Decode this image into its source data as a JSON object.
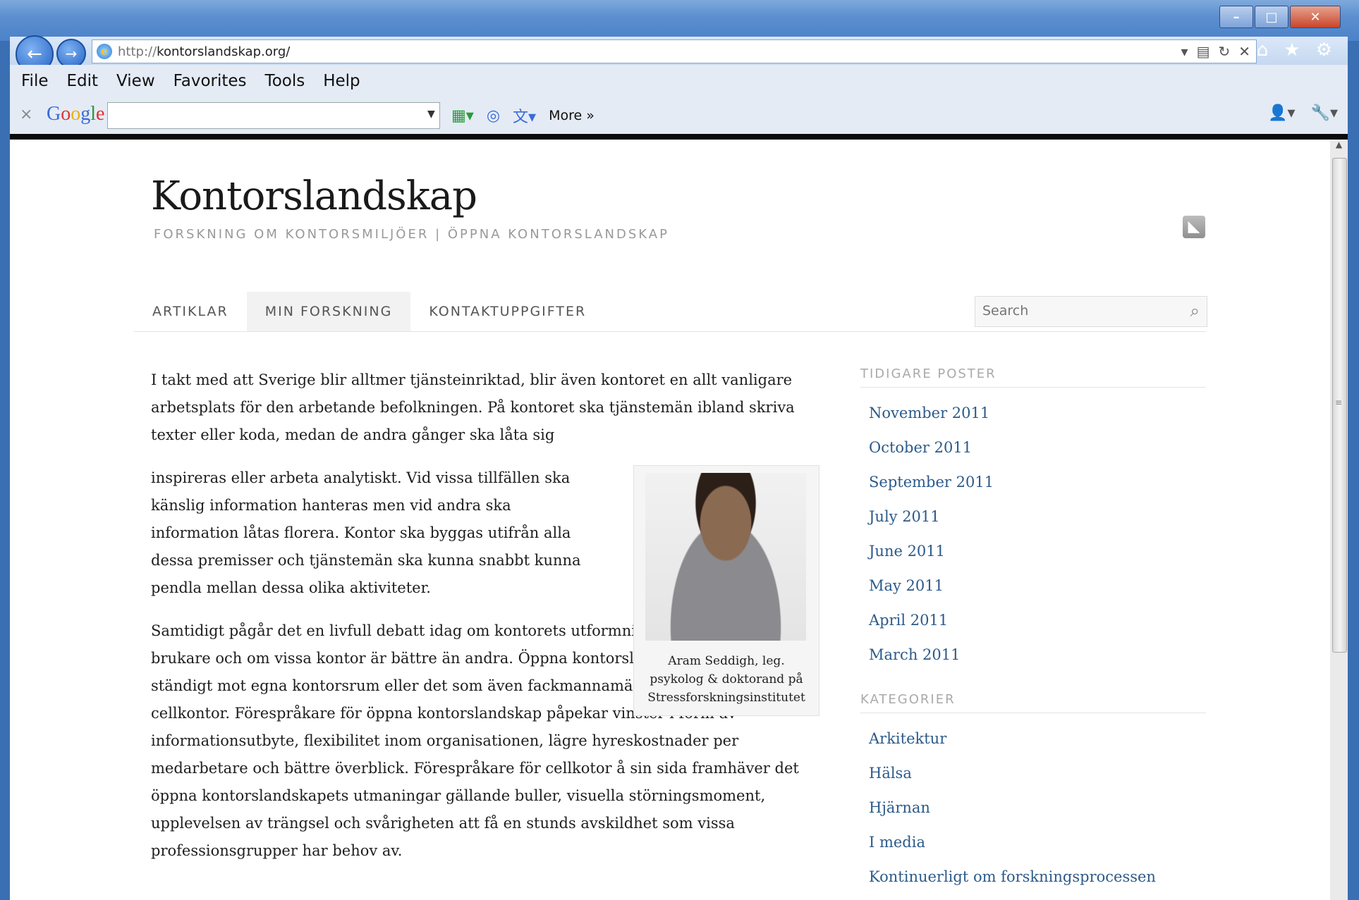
{
  "browser": {
    "url_prefix": "http://",
    "url": "kontorslandskap.org/",
    "menu": [
      "File",
      "Edit",
      "View",
      "Favorites",
      "Tools",
      "Help"
    ],
    "google_logo": "Google",
    "more_label": "More »"
  },
  "site": {
    "title": "Kontorslandskap",
    "description": "FORSKNING OM KONTORSMILJÖER | ÖPPNA KONTORSLANDSKAP",
    "nav": [
      "ARTIKLAR",
      "MIN FORSKNING",
      "KONTAKTUPPGIFTER"
    ],
    "search_placeholder": "Search"
  },
  "article": {
    "p1": "I takt med att Sverige blir alltmer tjänsteinriktad, blir även kontoret en allt vanligare arbetsplats för den arbetande befolkningen. På kontoret ska tjänstemän ibland skriva texter eller koda, medan de andra gånger ska låta sig",
    "p2": "inspireras eller arbeta analytiskt. Vid vissa tillfällen ska känslig information hanteras men vid andra ska information låtas florera. Kontor ska byggas utifrån alla dessa premisser och tjänstemän ska kunna snabbt kunna pendla mellan dessa olika aktiviteter.",
    "p3": "Samtidigt pågår det en livfull debatt idag om kontorets utformning påverkar dess brukare och om vissa kontor är bättre än andra. Öppna kontorslandskap kontrasteras ständigt mot egna kontorsrum eller det som även fackmannamässigt också kallas för cellkontor. Förespråkare för öppna kontorslandskap påpekar vinster i form av informationsutbyte, flexibilitet inom organisationen, lägre hyreskostnader per medarbetare och bättre överblick. Förespråkare för cellkotor å sin sida framhäver det öppna kontorslandskapets utmaningar gällande buller, visuella störningsmoment, upplevelsen av trängsel och svårigheten att få en stunds avskildhet som vissa professionsgrupper har behov av.",
    "caption": "Aram Seddigh, leg. psykolog & doktorand på Stressforskningsinstitutet"
  },
  "sidebar": {
    "archive_title": "TIDIGARE POSTER",
    "archive": [
      "November 2011",
      "October 2011",
      "September 2011",
      "July 2011",
      "June 2011",
      "May 2011",
      "April 2011",
      "March 2011"
    ],
    "categories_title": "KATEGORIER",
    "categories": [
      "Arkitektur",
      "Hälsa",
      "Hjärnan",
      "I media",
      "Kontinuerligt om forskningsprocessen"
    ]
  }
}
